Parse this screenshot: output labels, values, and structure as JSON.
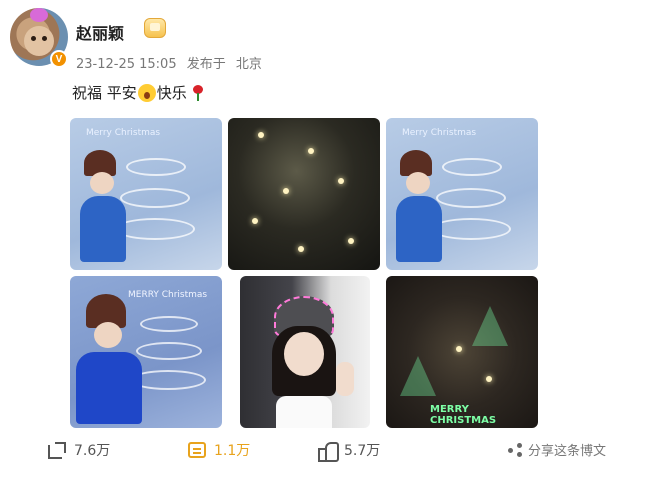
{
  "post": {
    "username": "赵丽颖",
    "timestamp": "23-12-25 15:05",
    "location_prefix": "发布于",
    "location": "北京",
    "caption_parts": [
      "祝福 平安",
      "快乐"
    ],
    "avatar_icon": "avatar-icon",
    "verified_icon": "verified-icon",
    "badge_icon": "member-crown-icon"
  },
  "photos": [
    {
      "name": "photo-1",
      "caption": "Merry Christmas"
    },
    {
      "name": "photo-2",
      "caption": ""
    },
    {
      "name": "photo-3",
      "caption": "Merry Christmas"
    },
    {
      "name": "photo-4",
      "caption": "MERRY Christmas"
    },
    {
      "name": "photo-5",
      "caption": ""
    },
    {
      "name": "photo-6",
      "caption": "MERRY CHRISTMAS"
    }
  ],
  "actions": {
    "repost": {
      "value": "7.6万",
      "icon": "repost-icon"
    },
    "comment": {
      "value": "1.1万",
      "icon": "comment-icon"
    },
    "like": {
      "value": "5.7万",
      "icon": "like-icon"
    }
  },
  "footer": {
    "watermark_text": "分享这条博文",
    "watermark_icon": "share-icon"
  },
  "colors": {
    "comment_accent": "#e8a31d",
    "verified": "#f29100",
    "text_primary": "#222222",
    "text_meta": "#777777"
  }
}
